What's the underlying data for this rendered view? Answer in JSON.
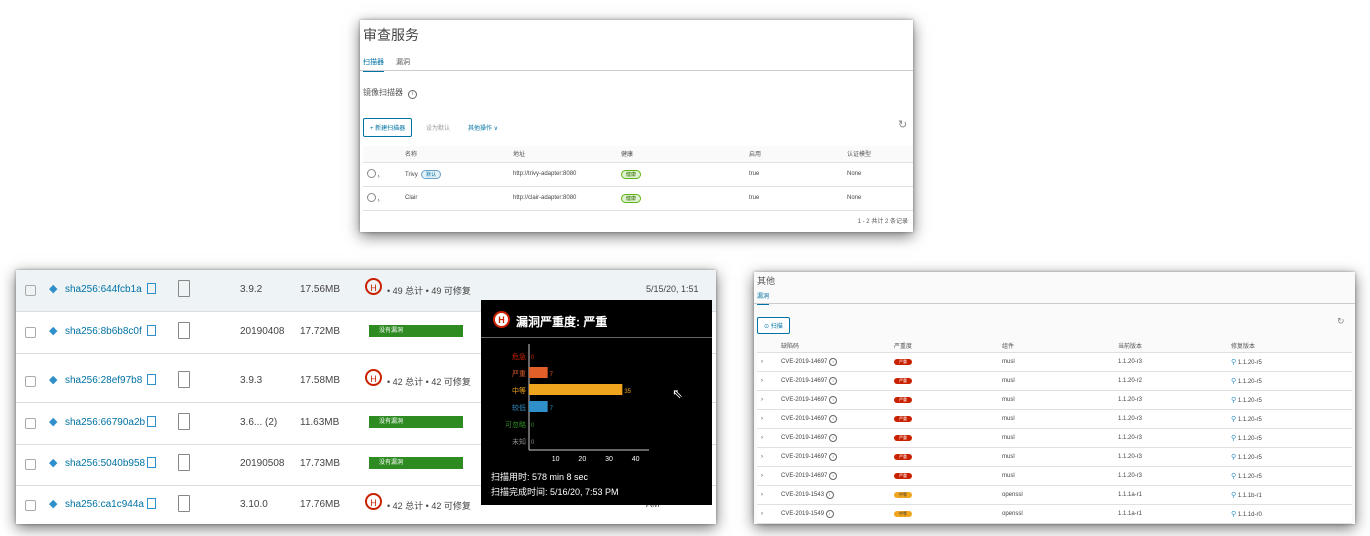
{
  "top_panel": {
    "title": "审查服务",
    "tabs": [
      "扫描器",
      "漏洞"
    ],
    "section_title": "镜像扫描器",
    "info_icon": "info-icon",
    "buttons": {
      "new": "+ 新建扫描器",
      "set_default": "设为默认",
      "other": "其他操作 ∨"
    },
    "refresh_icon": "refresh-icon",
    "columns": [
      "名称",
      "地址",
      "健康",
      "启用",
      "认证模型"
    ],
    "rows": [
      {
        "name": "Trivy",
        "badge": "默认",
        "url": "http://trivy-adapter:8080",
        "health": "健康",
        "enabled": "true",
        "auth": "None"
      },
      {
        "name": "Clair",
        "badge": "",
        "url": "http://clair-adapter:8080",
        "health": "健康",
        "enabled": "true",
        "auth": "None"
      }
    ],
    "footer": "1 - 2 共计 2 条记录"
  },
  "artifacts": {
    "rows": [
      {
        "digest": "sha256:644fcb1a",
        "tag": "3.9.2",
        "size": "17.56MB",
        "status": "vuln",
        "total": "49 总计",
        "fixable": "49 可修复",
        "date": "5/15/20, 1:51"
      },
      {
        "digest": "sha256:8b6b8c0f",
        "tag": "20190408",
        "size": "17.72MB",
        "status": "clean",
        "label": "没有漏洞"
      },
      {
        "digest": "sha256:28ef97b8",
        "tag": "3.9.3",
        "size": "17.58MB",
        "status": "vuln",
        "total": "42 总计",
        "fixable": "42 可修复"
      },
      {
        "digest": "sha256:66790a2b",
        "tag": "3.6... (2)",
        "size": "11.63MB",
        "status": "clean",
        "label": "没有漏洞"
      },
      {
        "digest": "sha256:5040b958",
        "tag": "20190508",
        "size": "17.73MB",
        "status": "clean",
        "label": "没有漏洞"
      },
      {
        "digest": "sha256:ca1c944a",
        "tag": "3.10.0",
        "size": "17.76MB",
        "status": "vuln",
        "total": "42 总计",
        "fixable": "42 可修复",
        "date": "AM"
      }
    ],
    "severity_letter": "H"
  },
  "tooltip": {
    "title": "漏洞严重度: 严重",
    "letter": "H",
    "scan_duration": "扫描用时: 578 min 8 sec",
    "scan_completed": "扫描完成时间: 5/16/20, 7:53 PM"
  },
  "chart_data": {
    "type": "bar",
    "orientation": "horizontal",
    "categories": [
      "危急",
      "严重",
      "中等",
      "较低",
      "可忽略",
      "未知"
    ],
    "values": [
      0,
      7,
      35,
      7,
      0,
      0
    ],
    "colors": [
      "#c92100",
      "#e25f2a",
      "#f0a51e",
      "#2f8fca",
      "#2e8b22",
      "#888888"
    ],
    "xticks": [
      "10",
      "20",
      "30",
      "40"
    ],
    "xlim": [
      0,
      45
    ]
  },
  "right_panel": {
    "title": "其他",
    "tab": "漏洞",
    "scan_button": "⊙ 扫描",
    "columns": [
      "缺陷码",
      "严重度",
      "组件",
      "当前版本",
      "修复版本"
    ],
    "rows": [
      {
        "cve": "CVE-2019-14697",
        "sev": "严重",
        "pkg": "musl",
        "ver": "1.1.20-r3",
        "fix": "1.1.20-r5"
      },
      {
        "cve": "CVE-2019-14697",
        "sev": "严重",
        "pkg": "musl",
        "ver": "1.1.20-r2",
        "fix": "1.1.20-r5"
      },
      {
        "cve": "CVE-2019-14697",
        "sev": "严重",
        "pkg": "musl",
        "ver": "1.1.20-r3",
        "fix": "1.1.20-r5"
      },
      {
        "cve": "CVE-2019-14697",
        "sev": "严重",
        "pkg": "musl",
        "ver": "1.1.20-r3",
        "fix": "1.1.20-r5"
      },
      {
        "cve": "CVE-2019-14697",
        "sev": "严重",
        "pkg": "musl",
        "ver": "1.1.20-r3",
        "fix": "1.1.20-r5"
      },
      {
        "cve": "CVE-2019-14697",
        "sev": "严重",
        "pkg": "musl",
        "ver": "1.1.20-r3",
        "fix": "1.1.20-r5"
      },
      {
        "cve": "CVE-2019-14697",
        "sev": "严重",
        "pkg": "musl",
        "ver": "1.1.20-r3",
        "fix": "1.1.20-r5"
      },
      {
        "cve": "CVE-2019-1543",
        "sev": "中等",
        "pkg": "openssl",
        "ver": "1.1.1a-r1",
        "fix": "1.1.1b-r1"
      },
      {
        "cve": "CVE-2019-1549",
        "sev": "中等",
        "pkg": "openssl",
        "ver": "1.1.1a-r1",
        "fix": "1.1.1d-r0"
      }
    ]
  }
}
